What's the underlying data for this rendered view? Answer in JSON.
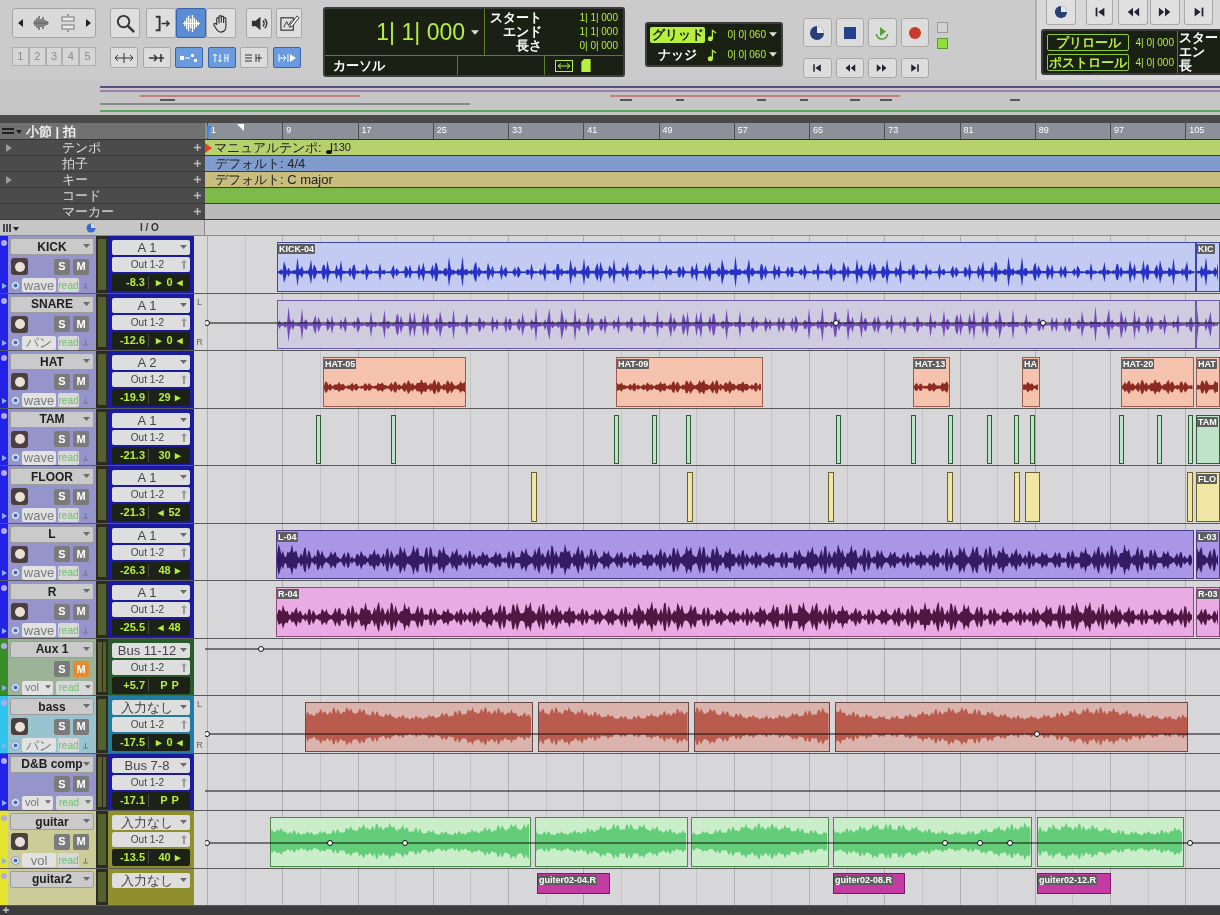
{
  "toolbar": {
    "zoom_presets": [
      "1",
      "2",
      "3",
      "4",
      "5"
    ],
    "tools": [
      {
        "selected": false
      },
      {
        "selected": false
      },
      {
        "selected": true
      },
      {
        "selected": false
      },
      {
        "selected": false
      },
      {
        "selected": false
      }
    ],
    "edit_toggles": [
      {
        "on": false
      },
      {
        "on": false
      },
      {
        "on": true
      },
      {
        "on": true
      },
      {
        "on": false
      },
      {
        "on": true
      }
    ],
    "counter": {
      "main": "1| 1| 000",
      "fields": [
        {
          "label": "スタート",
          "value": "1| 1| 000"
        },
        {
          "label": "エンド",
          "value": "1| 1| 000"
        },
        {
          "label": "長さ",
          "value": "0| 0| 000"
        }
      ],
      "mode": "カーソル"
    },
    "grid": {
      "label": "グリッド",
      "value": "0| 0| 060",
      "on": true
    },
    "nudge": {
      "label": "ナッジ",
      "value": "0| 0| 060",
      "on": false
    },
    "transport_lights": [
      {
        "on": false
      },
      {
        "on": true
      }
    ]
  },
  "transport_window": {
    "preroll": {
      "label": "プリロール",
      "value": "4| 0| 000"
    },
    "postroll": {
      "label": "ポストロール",
      "value": "4| 0| 000"
    },
    "fields": [
      "スター",
      "エン",
      "長"
    ]
  },
  "rulers": {
    "title": "小節 | 拍",
    "bars": [
      "1",
      "9",
      "17",
      "25",
      "33",
      "41",
      "49",
      "57",
      "65",
      "73",
      "81",
      "89",
      "97",
      "105"
    ],
    "rows": [
      {
        "label": "テンポ",
        "expandable": true,
        "kind": "tempo",
        "color": "#b6d06c",
        "text": "マニュアルテンポ:",
        "value": "130"
      },
      {
        "label": "拍子",
        "expandable": false,
        "kind": "text",
        "color": "#7f9ccd",
        "text": "デフォルト: 4/4"
      },
      {
        "label": "キー",
        "expandable": true,
        "kind": "text",
        "color": "#c9bd7e",
        "text": "デフォルト: C major"
      },
      {
        "label": "コード",
        "expandable": false,
        "kind": "empty",
        "color": "#7cba4a"
      },
      {
        "label": "マーカー",
        "expandable": false,
        "kind": "empty",
        "color": "#b9b9b9"
      }
    ]
  },
  "tracks_header": {
    "io": "I / O"
  },
  "tracks": [
    {
      "name": "KICK",
      "kind": "audio",
      "color": "#2222e6",
      "input": "A 1",
      "output": "Out 1-2",
      "volume": "-8.3",
      "pan": [
        "▸",
        "0",
        "◂"
      ],
      "view": "wave",
      "mode": "read",
      "solo": {
        "label": "S",
        "on": false
      },
      "mute": {
        "label": "M",
        "on": false
      },
      "clips": [
        {
          "label": "KICK-04"
        },
        {
          "label": "KIC"
        }
      ]
    },
    {
      "name": "SNARE",
      "kind": "audio",
      "color": "#2222e6",
      "input": "A 1",
      "output": "Out 1-2",
      "volume": "-12.6",
      "pan": [
        "▸",
        "0",
        "◂"
      ],
      "view": "パン",
      "mode": "read",
      "solo": {
        "label": "S",
        "on": false
      },
      "mute": {
        "label": "M",
        "on": false
      },
      "scale": [
        "L",
        "R"
      ]
    },
    {
      "name": "HAT",
      "kind": "audio",
      "color": "#2222e6",
      "input": "A 2",
      "output": "Out 1-2",
      "volume": "-19.9",
      "pan": [
        "29",
        "▸"
      ],
      "view": "wave",
      "mode": "read",
      "solo": {
        "label": "S",
        "on": false
      },
      "mute": {
        "label": "M",
        "on": false
      },
      "clips": [
        {
          "label": "HAT-05"
        },
        {
          "label": "HAT-09"
        },
        {
          "label": "HAT-13"
        },
        {
          "label": "HA"
        },
        {
          "label": "HAT-20"
        },
        {
          "label": "HAT"
        }
      ]
    },
    {
      "name": "TAM",
      "kind": "audio",
      "color": "#2222e6",
      "input": "A 1",
      "output": "Out 1-2",
      "volume": "-21.3",
      "pan": [
        "30",
        "▸"
      ],
      "view": "wave",
      "mode": "read",
      "solo": {
        "label": "S",
        "on": false
      },
      "mute": {
        "label": "M",
        "on": false
      },
      "clips": [
        {
          "label": "TAM"
        }
      ]
    },
    {
      "name": "FLOOR",
      "kind": "audio",
      "color": "#2222e6",
      "input": "A 1",
      "output": "Out 1-2",
      "volume": "-21.3",
      "pan": [
        "◂",
        "52"
      ],
      "view": "wave",
      "mode": "read",
      "solo": {
        "label": "S",
        "on": false
      },
      "mute": {
        "label": "M",
        "on": false
      },
      "clips": [
        {
          "label": "FLO"
        }
      ]
    },
    {
      "name": "L",
      "kind": "audio",
      "color": "#2222e6",
      "input": "A 1",
      "output": "Out 1-2",
      "volume": "-26.3",
      "pan": [
        "48",
        "▸"
      ],
      "view": "wave",
      "mode": "read",
      "solo": {
        "label": "S",
        "on": false
      },
      "mute": {
        "label": "M",
        "on": false
      },
      "clips": [
        {
          "label": "L-04"
        },
        {
          "label": "L-03"
        }
      ]
    },
    {
      "name": "R",
      "kind": "audio",
      "color": "#2222e6",
      "input": "A 1",
      "output": "Out 1-2",
      "volume": "-25.5",
      "pan": [
        "◂",
        "48"
      ],
      "view": "wave",
      "mode": "read",
      "solo": {
        "label": "S",
        "on": false
      },
      "mute": {
        "label": "M",
        "on": false
      },
      "clips": [
        {
          "label": "R-04"
        },
        {
          "label": "R-03"
        }
      ]
    },
    {
      "name": "Aux 1",
      "kind": "aux",
      "color": "#3a8c2a",
      "input": "Bus 11-12",
      "output": "Out 1-2",
      "volume": "+5.7",
      "pan": [
        "P",
        "P"
      ],
      "view": "vol",
      "mode": "read",
      "solo": {
        "label": "S",
        "on": false
      },
      "mute": {
        "label": "M",
        "on": true
      }
    },
    {
      "name": "bass",
      "kind": "audio",
      "color": "#2ec4ee",
      "input": "入力なし",
      "output": "Out 1-2",
      "volume": "-17.5",
      "pan": [
        "▸",
        "0",
        "◂"
      ],
      "view": "パン",
      "mode": "read",
      "solo": {
        "label": "S",
        "on": false
      },
      "mute": {
        "label": "M",
        "on": false
      },
      "scale": [
        "L",
        "R"
      ]
    },
    {
      "name": "D&B comp",
      "kind": "aux",
      "color": "#2222e6",
      "input": "Bus 7-8",
      "output": "Out 1-2",
      "volume": "-17.1",
      "pan": [
        "P",
        "P"
      ],
      "view": "vol",
      "mode": "read",
      "solo": {
        "label": "S",
        "on": false
      },
      "mute": {
        "label": "M",
        "on": false
      }
    },
    {
      "name": "guitar",
      "kind": "audio",
      "color": "#e4e42c",
      "input": "入力なし",
      "output": "Out 1-2",
      "volume": "-13.5",
      "pan": [
        "40",
        "▸"
      ],
      "view": "vol",
      "mode": "read",
      "solo": {
        "label": "S",
        "on": false
      },
      "mute": {
        "label": "M",
        "on": false
      }
    },
    {
      "name": "guitar2",
      "kind": "audio",
      "color": "#e4e42c",
      "input": "入力なし",
      "clips": [
        {
          "label": "guiter02-04.R"
        },
        {
          "label": "guiter02-08.R"
        },
        {
          "label": "guiter02-12.R"
        }
      ]
    }
  ]
}
